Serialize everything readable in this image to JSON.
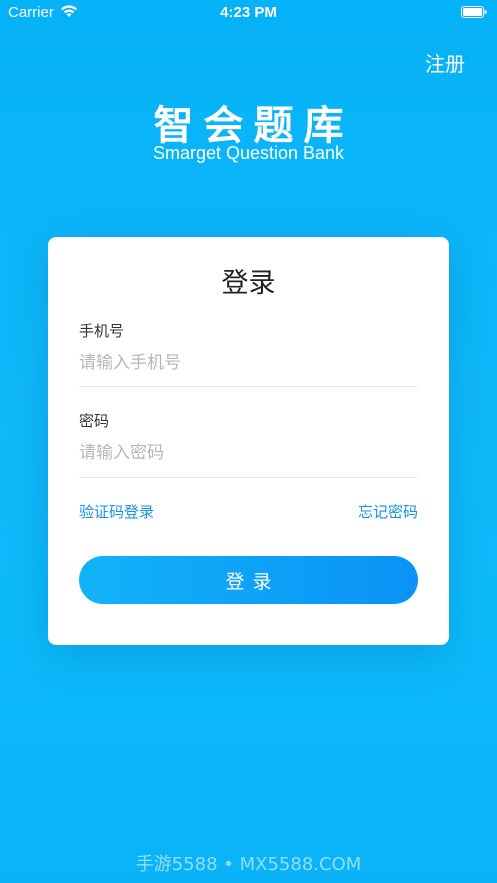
{
  "status_bar": {
    "carrier": "Carrier",
    "time": "4:23 PM",
    "wifi_icon": "wifi-icon",
    "battery_icon": "battery-icon"
  },
  "header": {
    "register_label": "注册",
    "app_title": "智会题库",
    "app_subtitle": "Smarget Question Bank"
  },
  "login_form": {
    "title": "登录",
    "phone": {
      "label": "手机号",
      "placeholder": "请输入手机号",
      "value": ""
    },
    "password": {
      "label": "密码",
      "placeholder": "请输入密码",
      "value": ""
    },
    "sms_login_label": "验证码登录",
    "forgot_password_label": "忘记密码",
    "submit_label": "登录"
  },
  "watermark": "手游5588 • MX5588.COM",
  "colors": {
    "background": "#0fb8f9",
    "accent": "#1592e6",
    "button_start": "#12b3f8",
    "button_end": "#0a92f6"
  }
}
